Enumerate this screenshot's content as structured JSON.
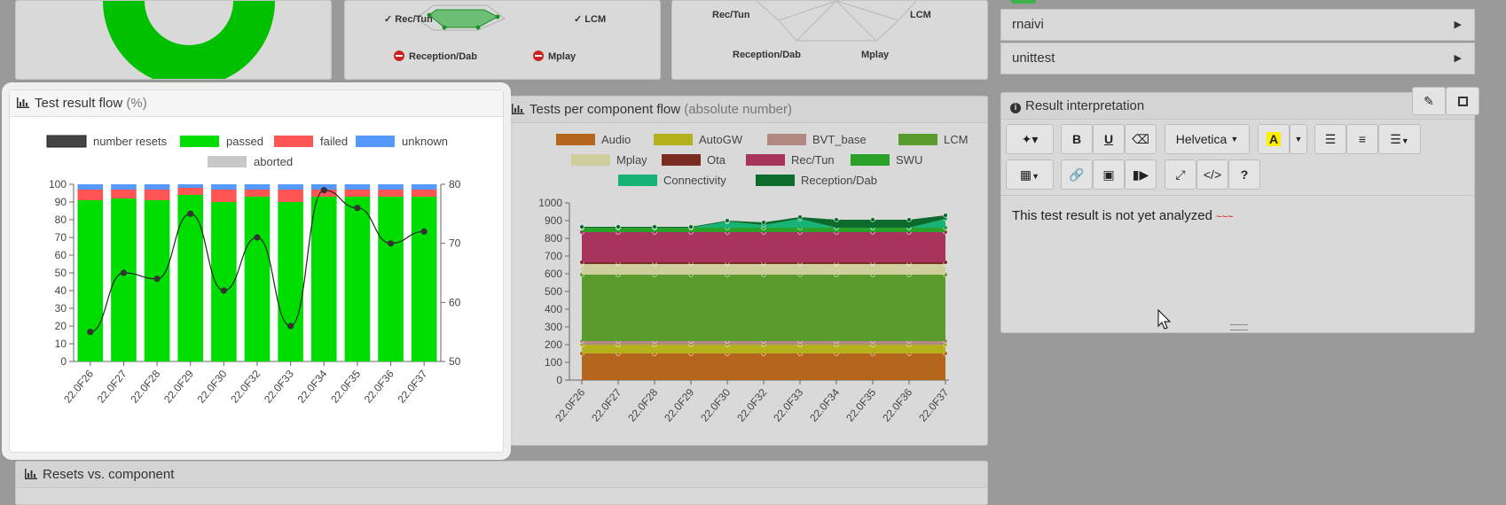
{
  "top_panels": {
    "radar1_labels": [
      "Rec/Tun",
      "LCM",
      "Reception/Dab",
      "Mplay"
    ],
    "radar2_labels": [
      "Rec/Tun",
      "LCM",
      "Reception/Dab",
      "Mplay"
    ]
  },
  "accordion": [
    {
      "label": "rnaivi"
    },
    {
      "label": "unittest"
    }
  ],
  "flow_panel": {
    "title": "Test result flow",
    "subtitle": "(%)",
    "legend": [
      {
        "name": "number resets",
        "color": "#444444"
      },
      {
        "name": "passed",
        "color": "#00dd00"
      },
      {
        "name": "failed",
        "color": "#ff5555"
      },
      {
        "name": "unknown",
        "color": "#5599ff"
      },
      {
        "name": "aborted",
        "color": "#c8c8c8"
      }
    ]
  },
  "component_panel": {
    "title": "Tests per component flow",
    "subtitle": "(absolute number)",
    "legend": [
      {
        "name": "Audio",
        "color": "#b5661c"
      },
      {
        "name": "AutoGW",
        "color": "#b5b11c"
      },
      {
        "name": "BVT_base",
        "color": "#b08a80"
      },
      {
        "name": "LCM",
        "color": "#5b9a2c"
      },
      {
        "name": "Mplay",
        "color": "#cfcf9e"
      },
      {
        "name": "Ota",
        "color": "#7a2c22"
      },
      {
        "name": "Rec/Tun",
        "color": "#a8345e"
      },
      {
        "name": "SWU",
        "color": "#2aa22a"
      },
      {
        "name": "Connectivity",
        "color": "#17b374"
      },
      {
        "name": "Reception/Dab",
        "color": "#0c6b2c"
      }
    ]
  },
  "result_panel": {
    "title": "Result interpretation",
    "font_select": "Helvetica",
    "editor_text": "This test result is not yet analyzed",
    "toolbar_icons": [
      "magic-icon",
      "bold-icon",
      "underline-icon",
      "eraser-icon",
      "font-dropdown",
      "text-color-icon",
      "color-caret-icon",
      "bullet-list-icon",
      "ordered-list-icon",
      "align-icon",
      "table-icon",
      "link-icon",
      "image-icon",
      "video-icon",
      "fullscreen-icon",
      "code-view-icon",
      "help-icon"
    ]
  },
  "resets_panel": {
    "title": "Resets vs. component"
  },
  "chart_data": [
    {
      "type": "bar",
      "title": "",
      "categories": [
        "22.0F26",
        "22.0F27",
        "22.0F28",
        "22.0F29",
        "22.0F30",
        "22.0F32",
        "22.0F33",
        "22.0F34",
        "22.0F35",
        "22.0F36",
        "22.0F37"
      ],
      "series": [
        {
          "name": "passed",
          "values": [
            91,
            92,
            91,
            94,
            90,
            93,
            90,
            93,
            93,
            93,
            93
          ]
        },
        {
          "name": "failed",
          "values": [
            6,
            5,
            6,
            4,
            7,
            4,
            7,
            4,
            4,
            4,
            4
          ]
        },
        {
          "name": "unknown",
          "values": [
            3,
            3,
            3,
            2,
            3,
            3,
            3,
            3,
            3,
            3,
            3
          ]
        },
        {
          "name": "aborted",
          "values": [
            0,
            0,
            0,
            0,
            0,
            0,
            0,
            0,
            0,
            0,
            0
          ]
        },
        {
          "name": "number resets",
          "values": [
            55,
            65,
            64,
            75,
            62,
            71,
            56,
            79,
            76,
            70,
            72
          ],
          "axis": "right"
        }
      ],
      "ylim": [
        0,
        100
      ],
      "y_ticks": [
        0,
        10,
        20,
        30,
        40,
        50,
        60,
        70,
        80,
        90,
        100
      ],
      "y2lim": [
        50,
        80
      ],
      "y2_ticks": [
        50,
        60,
        70,
        80
      ],
      "stacked": true,
      "legend": "top"
    },
    {
      "type": "area",
      "title": "",
      "categories": [
        "22.0F26",
        "22.0F27",
        "22.0F28",
        "22.0F29",
        "22.0F30",
        "22.0F32",
        "22.0F33",
        "22.0F34",
        "22.0F35",
        "22.0F36",
        "22.0F37"
      ],
      "series": [
        {
          "name": "Audio",
          "values": [
            150,
            150,
            150,
            150,
            150,
            150,
            150,
            150,
            150,
            150,
            150
          ]
        },
        {
          "name": "AutoGW",
          "values": [
            50,
            50,
            50,
            50,
            50,
            50,
            50,
            50,
            50,
            50,
            50
          ]
        },
        {
          "name": "BVT_base",
          "values": [
            20,
            20,
            20,
            20,
            20,
            20,
            20,
            20,
            20,
            20,
            20
          ]
        },
        {
          "name": "LCM",
          "values": [
            375,
            375,
            375,
            375,
            375,
            375,
            375,
            375,
            375,
            375,
            375
          ]
        },
        {
          "name": "Mplay",
          "values": [
            60,
            60,
            60,
            60,
            60,
            60,
            60,
            60,
            60,
            60,
            60
          ]
        },
        {
          "name": "Ota",
          "values": [
            10,
            10,
            10,
            10,
            10,
            10,
            10,
            10,
            10,
            10,
            10
          ]
        },
        {
          "name": "Rec/Tun",
          "values": [
            170,
            170,
            170,
            170,
            170,
            170,
            170,
            170,
            170,
            170,
            170
          ]
        },
        {
          "name": "SWU",
          "values": [
            25,
            25,
            25,
            25,
            25,
            25,
            25,
            25,
            25,
            25,
            25
          ]
        },
        {
          "name": "Connectivity",
          "values": [
            0,
            0,
            0,
            0,
            35,
            15,
            50,
            0,
            0,
            0,
            50
          ]
        },
        {
          "name": "Reception/Dab",
          "values": [
            5,
            5,
            5,
            5,
            5,
            15,
            10,
            45,
            45,
            45,
            20
          ]
        }
      ],
      "ylim": [
        0,
        1000
      ],
      "y_ticks": [
        0,
        100,
        200,
        300,
        400,
        500,
        600,
        700,
        800,
        900,
        1000
      ],
      "stacked": true,
      "legend": "top"
    }
  ]
}
